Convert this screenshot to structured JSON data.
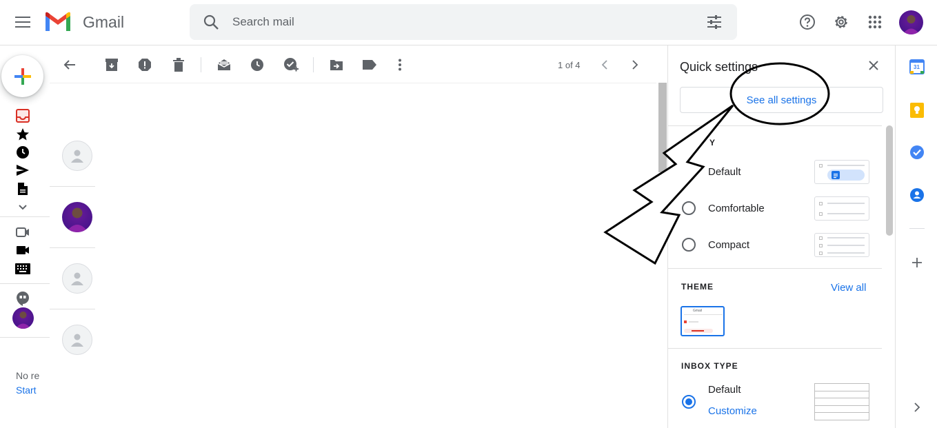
{
  "header": {
    "brand": "Gmail",
    "search": {
      "placeholder": "Search mail"
    },
    "icons": [
      "menu-icon",
      "gmail-logo-icon",
      "search-icon",
      "search-options-icon",
      "help-icon",
      "settings-icon",
      "apps-icon",
      "account-avatar"
    ]
  },
  "rail": {
    "icons": [
      "compose-icon",
      "inbox-icon",
      "starred-icon",
      "snoozed-icon",
      "sent-icon",
      "drafts-icon",
      "more-icon",
      "meet-new-icon",
      "meet-join-icon",
      "keyboard-icon",
      "hangouts-icon",
      "hangouts-avatar"
    ],
    "no_recent_text": "No re",
    "start_link": "Start"
  },
  "toolbar": {
    "icons": [
      "back-icon",
      "archive-icon",
      "report-spam-icon",
      "delete-icon",
      "mark-unread-icon",
      "snooze-icon",
      "add-to-tasks-icon",
      "move-to-icon",
      "labels-icon",
      "more-options-icon"
    ],
    "pager": "1 of 4"
  },
  "quick_settings": {
    "title": "Quick settings",
    "see_all": "See all settings",
    "density": {
      "title_partial": "Y",
      "options": [
        {
          "label": "Default",
          "selected": true
        },
        {
          "label": "Comfortable",
          "selected": false
        },
        {
          "label": "Compact",
          "selected": false
        }
      ]
    },
    "theme": {
      "title": "THEME",
      "view_all": "View all",
      "thumb_text": "Gmail"
    },
    "inbox_type": {
      "title": "INBOX TYPE",
      "default_label": "Default",
      "customize": "Customize"
    }
  },
  "side_panel": {
    "icons": [
      "calendar-icon",
      "keep-icon",
      "tasks-icon",
      "contacts-icon",
      "add-addon-icon",
      "show-side-panel-icon"
    ],
    "calendar_day": "31"
  },
  "colors": {
    "accent": "#1a73e8",
    "avatar_purple": "#7b1fa2",
    "text_dark": "#202124",
    "text_muted": "#5f6368"
  }
}
